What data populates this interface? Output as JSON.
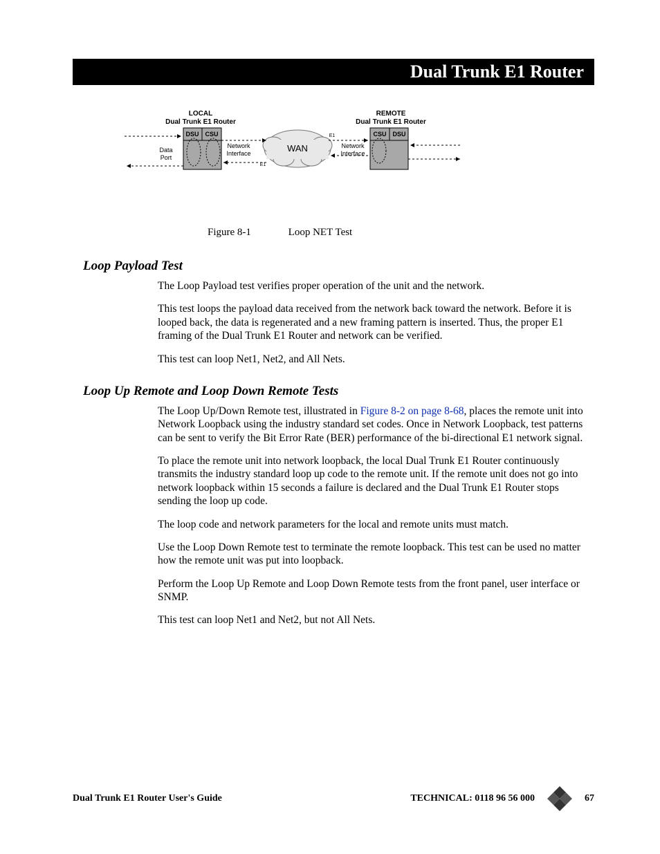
{
  "header": {
    "title": "Dual Trunk E1 Router"
  },
  "diagram": {
    "local": {
      "title1": "LOCAL",
      "title2": "Dual Trunk E1 Router",
      "dsu": "DSU",
      "csu": "CSU",
      "data_port1": "Data",
      "data_port2": "Port",
      "net_if1": "Network",
      "net_if2": "Interface"
    },
    "wan": "WAN",
    "e1a": "E1",
    "e1b": "E1",
    "remote": {
      "title1": "REMOTE",
      "title2": "Dual Trunk E1 Router",
      "dsu": "DSU",
      "csu": "CSU",
      "net_if1": "Network",
      "net_if2": "Interface"
    }
  },
  "figure": {
    "num": "Figure 8-1",
    "title": "Loop NET Test"
  },
  "section1": {
    "heading": "Loop Payload Test",
    "p1": "The Loop Payload test verifies proper operation of the unit and the  network.",
    "p2": "This test loops the payload data received from the network back toward the network. Before it is looped back, the data is regenerated and a new framing pattern is inserted. Thus, the proper E1 framing of the Dual Trunk E1 Router and network can be verified.",
    "p3": "This test can loop Net1, Net2, and All Nets."
  },
  "section2": {
    "heading": "Loop Up Remote and Loop Down Remote Tests",
    "p1a": "The Loop Up/Down Remote test, illustrated in ",
    "p1link": "Figure 8-2 on page 8-68",
    "p1b": ", places the remote unit into Network Loopback using the industry standard set codes. Once in Network Loopback, test patterns can be sent to verify the Bit Error Rate (BER) performance of the bi-directional E1 network signal.",
    "p2": "To place the remote unit into network loopback, the local Dual Trunk E1 Router continuously transmits the industry standard loop up code to the remote unit. If the remote unit does not go into network loopback within 15 seconds a failure is declared and the Dual Trunk E1 Router stops sending the loop up code.",
    "p3": "The loop code and network parameters for the local and remote units must match.",
    "p4": "Use the Loop Down Remote test to terminate the remote loopback. This test can be used no matter how the remote unit was put into loopback.",
    "p5": "Perform the Loop Up Remote and Loop Down Remote tests from the front panel, user interface or SNMP.",
    "p6": "This test can loop Net1 and Net2, but not All Nets."
  },
  "footer": {
    "left": "Dual Trunk E1 Router User's Guide",
    "tech": "TECHNICAL:  0118 96 56 000",
    "page": "67"
  }
}
